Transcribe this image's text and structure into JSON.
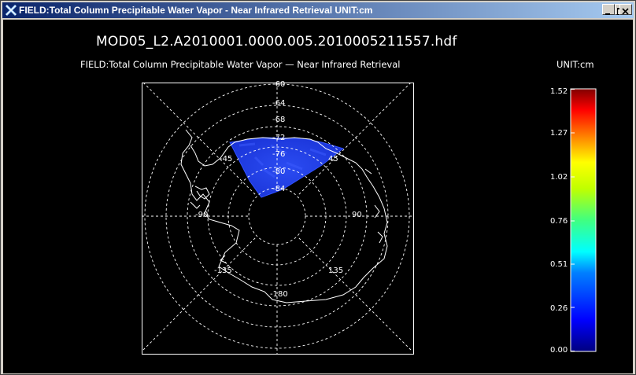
{
  "window": {
    "title": "FIELD:Total Column Precipitable Water Vapor - Near Infrared Retrieval  UNIT:cm",
    "icon": "idl-x-icon",
    "buttons": {
      "minimize": "minimize-icon",
      "maximize": "maximize-icon",
      "close": "close-icon"
    }
  },
  "plot": {
    "file_name": "MOD05_L2.A2010001.0000.005.2010005211557.hdf",
    "field_title": "FIELD:Total Column Precipitable Water Vapor — Near Infrared Retrieval",
    "unit_label": "UNIT:cm",
    "latitude_labels": [
      "-60",
      "-64",
      "-68",
      "-72",
      "-76",
      "-80",
      "-84"
    ],
    "longitude_labels": [
      "-45",
      "45",
      "-90",
      "90",
      "-135",
      "135",
      "-180"
    ],
    "colorbar_ticks": [
      "1.52",
      "1.27",
      "1.02",
      "0.76",
      "0.51",
      "0.26",
      "0.00"
    ],
    "colors": {
      "background": "#000000",
      "grid": "#ffffff",
      "data": "#1e3ce6"
    }
  }
}
